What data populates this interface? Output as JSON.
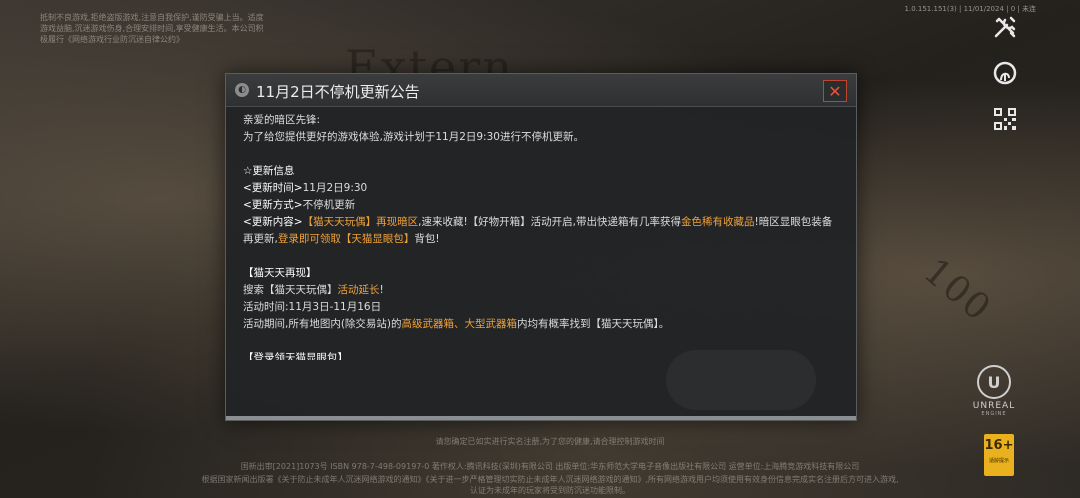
{
  "background": {
    "heading_text": "Extern",
    "number_text": "100"
  },
  "top_notice": "抵制不良游戏,拒绝盗版游戏,注意自我保护,谨防受骗上当。适度游戏益脑,沉迷游戏伤身,合理安排时间,享受健康生活。本公司积极履行《网络游戏行业防沉迷自律公约》",
  "version": "1.0.151.151(3) | 11/01/2024 | 0 | 未连",
  "side_icons": [
    "tools-icon",
    "fingerprint-icon",
    "qr-code-icon"
  ],
  "unreal": {
    "label": "UNREAL",
    "sub": "ENGINE"
  },
  "age_rating": {
    "value": "16+",
    "sub": "适龄提示"
  },
  "footer": {
    "line1": "请您确定已如实进行实名注册,为了您的健康,请合理控制游戏时间",
    "line2": "国新出审[2021]1073号  ISBN 978-7-498-09197-0  著作权人:腾讯科技(深圳)有限公司  出版单位:华东师范大学电子音像出版社有限公司  运营单位:上海腾竞游戏科技有限公司",
    "line3": "根据国家新闻出版署《关于防止未成年人沉迷网络游戏的通知》《关于进一步严格管理切实防止未成年人沉迷网络游戏的通知》,所有网络游戏用户均须使用有效身份信息完成实名注册后方可进入游戏,",
    "line4": "认证为未成年的玩家将受到防沉迷功能限制。"
  },
  "dialog": {
    "title": "11月2日不停机更新公告",
    "close_symbol": "✕",
    "greeting": "亲爱的暗区先锋:",
    "intro": "为了给您提供更好的游戏体验,游戏计划于11月2日9:30进行不停机更新。",
    "update_info_title": "☆更新信息",
    "time_label": "<更新时间>",
    "time_value": "11月2日9:30",
    "method_label": "<更新方式>",
    "method_value": "不停机更新",
    "content_label": "<更新内容>",
    "content_hl1": "【猫天天玩偶】再现暗区",
    "content_t1": ",速来收藏!【好物开箱】活动开启,带出快递箱有几率获得",
    "content_hl2": "金色稀有收藏品",
    "content_t2": "!暗区显眼包装备再更新,",
    "content_hl3": "登录即可领取【天猫显眼包】",
    "content_t3": "背包!",
    "section2_title": "【猫天天再现】",
    "search_t1": "搜索【猫天天玩偶】",
    "search_hl": "活动延长",
    "search_t2": "!",
    "period": "活动时间:11月3日-11月16日",
    "during_t1": "活动期间,所有地图内(除交易站)的",
    "during_hl": "高级武器箱、大型武器箱",
    "during_t2": "内均有概率找到【猫天天玩偶】。",
    "section3_title": "【登录领天猫显眼包】"
  }
}
